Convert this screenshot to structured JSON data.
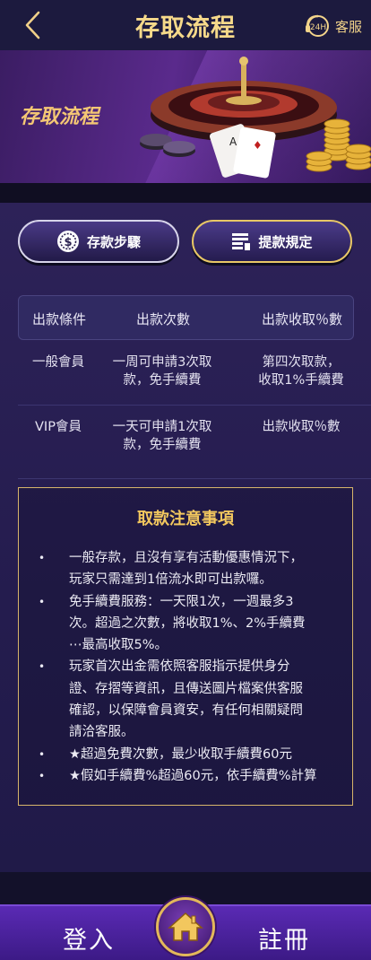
{
  "header": {
    "title": "存取流程",
    "service_badge": "24H",
    "service_label": "客服"
  },
  "banner": {
    "title": "存取流程"
  },
  "tabs": [
    {
      "label": "存款步驟",
      "icon": "dollar-coin-icon"
    },
    {
      "label": "提款規定",
      "icon": "document-list-icon"
    }
  ],
  "table": {
    "headers": [
      "出款條件",
      "出款次數",
      "出款收取％數"
    ],
    "rows": [
      {
        "condition": "一般會員",
        "count_line1": "一周可申請3次取",
        "count_line2": "款，免手續費",
        "fee_line1": "第四次取款，",
        "fee_line2": "收取1%手續費"
      },
      {
        "condition": "VIP會員",
        "count_line1": "一天可申請1次取",
        "count_line2": "款，免手續費",
        "fee_line1": "出款收取％數",
        "fee_line2": ""
      }
    ]
  },
  "notice": {
    "title": "取款注意事項",
    "items": [
      {
        "lines": [
          "一般存款，且沒有享有活動優惠情況下，",
          "玩家只需達到1倍流水即可出款囉。"
        ]
      },
      {
        "lines": [
          "免手續費服務：一天限1次，一週最多3",
          "次。超過之次數，將收取1%、2%手續費",
          "⋯最高收取5%。"
        ]
      },
      {
        "lines": [
          "玩家首次出金需依照客服指示提供身分",
          "證、存摺等資訊，且傳送圖片檔案供客服",
          "確認，以保障會員資安，有任何相關疑問",
          "請洽客服。"
        ]
      },
      {
        "lines": [
          "★超過免費次數，最少收取手續費60元"
        ]
      },
      {
        "lines": [
          "★假如手續費%超過60元，依手續費%計算"
        ]
      }
    ]
  },
  "nav": {
    "login": "登入",
    "register": "註冊",
    "home_icon": "home-icon"
  },
  "colors": {
    "gold": "#f6d98a",
    "notice_border": "#d6b46a",
    "nav_purple": "#5a2ab4"
  }
}
